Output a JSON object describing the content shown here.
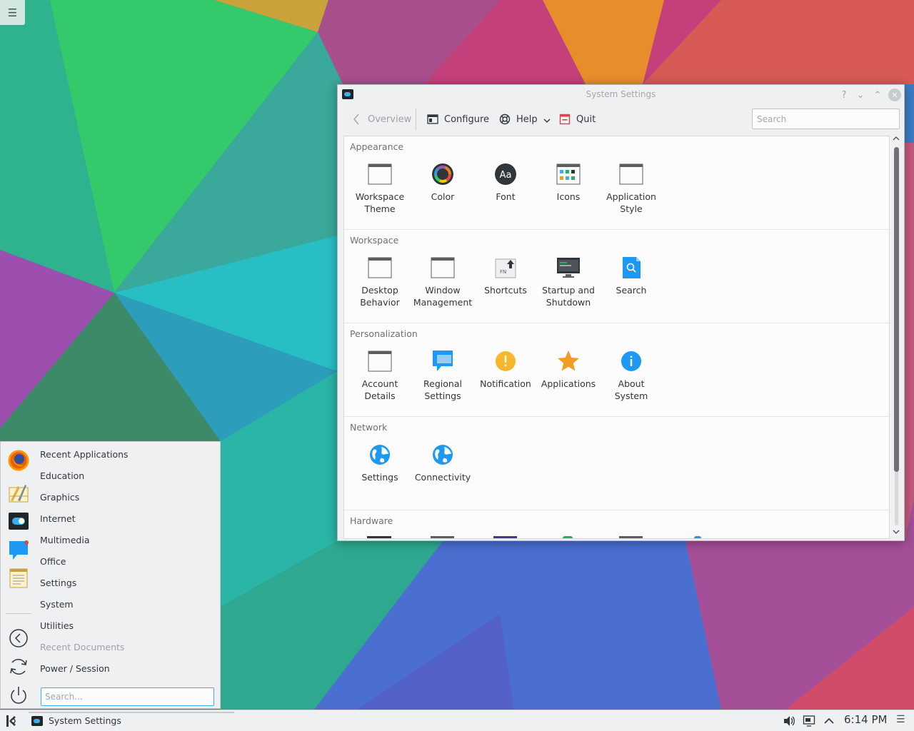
{
  "window": {
    "title": "System Settings",
    "help_glyph": "?",
    "minimize_glyph": "⌄",
    "maximize_glyph": "⌃",
    "close_glyph": "✕"
  },
  "toolbar": {
    "overview": "Overview",
    "configure": "Configure",
    "help": "Help",
    "quit": "Quit",
    "search_placeholder": "Search"
  },
  "categories": [
    {
      "title": "Appearance",
      "modules": [
        {
          "label_1": "Workspace",
          "label_2": "Theme",
          "icon": "window-icon"
        },
        {
          "label_1": "Color",
          "label_2": "",
          "icon": "color-wheel-icon"
        },
        {
          "label_1": "Font",
          "label_2": "",
          "icon": "font-icon"
        },
        {
          "label_1": "Icons",
          "label_2": "",
          "icon": "icons-grid-icon"
        },
        {
          "label_1": "Application",
          "label_2": "Style",
          "icon": "window-icon"
        }
      ]
    },
    {
      "title": "Workspace",
      "modules": [
        {
          "label_1": "Desktop",
          "label_2": "Behavior",
          "icon": "window-icon"
        },
        {
          "label_1": "Window",
          "label_2": "Management",
          "icon": "window-icon"
        },
        {
          "label_1": "Shortcuts",
          "label_2": "",
          "icon": "keyboard-key-icon"
        },
        {
          "label_1": "Startup and",
          "label_2": "Shutdown",
          "icon": "monitor-icon"
        },
        {
          "label_1": "Search",
          "label_2": "",
          "icon": "search-document-icon"
        }
      ]
    },
    {
      "title": "Personalization",
      "modules": [
        {
          "label_1": "Account",
          "label_2": "Details",
          "icon": "window-icon"
        },
        {
          "label_1": "Regional",
          "label_2": "Settings",
          "icon": "chat-monitor-icon"
        },
        {
          "label_1": "Notification",
          "label_2": "",
          "icon": "warning-icon"
        },
        {
          "label_1": "Applications",
          "label_2": "",
          "icon": "star-icon"
        },
        {
          "label_1": "About",
          "label_2": "System",
          "icon": "info-icon"
        }
      ]
    },
    {
      "title": "Network",
      "modules": [
        {
          "label_1": "Settings",
          "label_2": "",
          "icon": "globe-icon"
        },
        {
          "label_1": "Connectivity",
          "label_2": "",
          "icon": "globe-icon"
        }
      ]
    },
    {
      "title": "Hardware",
      "modules": []
    }
  ],
  "launcher": {
    "items": [
      "Recent Applications",
      "Education",
      "Graphics",
      "Internet",
      "Multimedia",
      "Office",
      "Settings",
      "System",
      "Utilities",
      "Recent Documents",
      "Power / Session"
    ],
    "search_placeholder": "Search..."
  },
  "panel": {
    "task_label": "System Settings",
    "clock": "6:14 PM"
  },
  "desktop": {
    "toolbox_glyph": "☰"
  },
  "colors": {
    "accent": "#3daee9",
    "window_bg": "#eff0f1",
    "view_bg": "#fcfcfc",
    "text": "#31363b"
  }
}
